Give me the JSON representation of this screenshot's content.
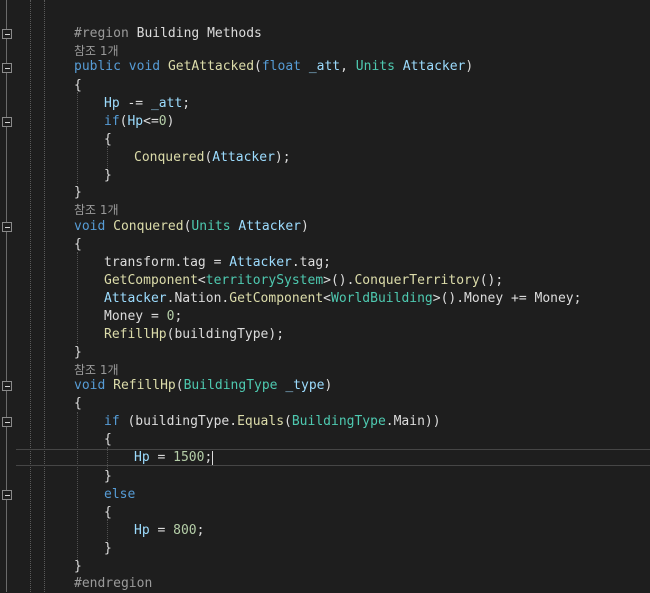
{
  "lines": {
    "l01": [
      "#region",
      " Building Methods"
    ],
    "l02": [
      "참조 1개"
    ],
    "l03": [
      "public",
      " ",
      "void",
      " ",
      "GetAttacked",
      "(",
      "float",
      " ",
      "_att",
      ", ",
      "Units",
      " ",
      "Attacker",
      ")"
    ],
    "l04": [
      "{"
    ],
    "l05": [
      "Hp",
      " -= ",
      "_att",
      ";"
    ],
    "l06": [
      "if",
      "(",
      "Hp",
      "<=",
      "0",
      ")"
    ],
    "l07": [
      "{"
    ],
    "l08": [
      "Conquered",
      "(",
      "Attacker",
      ");"
    ],
    "l09": [
      "}"
    ],
    "l10": [
      "}"
    ],
    "l11": [
      "참조 1개"
    ],
    "l12": [
      "void",
      " ",
      "Conquered",
      "(",
      "Units",
      " ",
      "Attacker",
      ")"
    ],
    "l13": [
      "{"
    ],
    "l14": [
      "transform.tag = ",
      "Attacker",
      ".tag;"
    ],
    "l15": [
      "GetComponent",
      "<",
      "territorySystem",
      ">().",
      "ConquerTerritory",
      "();"
    ],
    "l16": [
      "Attacker",
      ".Nation.",
      "GetComponent",
      "<",
      "WorldBuilding",
      ">().Money += Money;"
    ],
    "l17": [
      "Money = ",
      "0",
      ";"
    ],
    "l18": [
      "RefillHp",
      "(buildingType);"
    ],
    "l19": [
      "}"
    ],
    "l20": [
      "참조 1개"
    ],
    "l21": [
      "void",
      " ",
      "RefillHp",
      "(",
      "BuildingType",
      " ",
      "_type",
      ")"
    ],
    "l22": [
      "{"
    ],
    "l23": [
      "if",
      " (buildingType.",
      "Equals",
      "(",
      "BuildingType",
      ".Main))"
    ],
    "l24": [
      "{"
    ],
    "l25": [
      "Hp",
      " = ",
      "1500",
      ";"
    ],
    "l26": [
      "}"
    ],
    "l27": [
      "else"
    ],
    "l28": [
      "{"
    ],
    "l29": [
      "Hp",
      " = ",
      "800",
      ";"
    ],
    "l30": [
      "}"
    ],
    "l31": [
      "}"
    ],
    "l32": [
      "#endregion"
    ]
  }
}
